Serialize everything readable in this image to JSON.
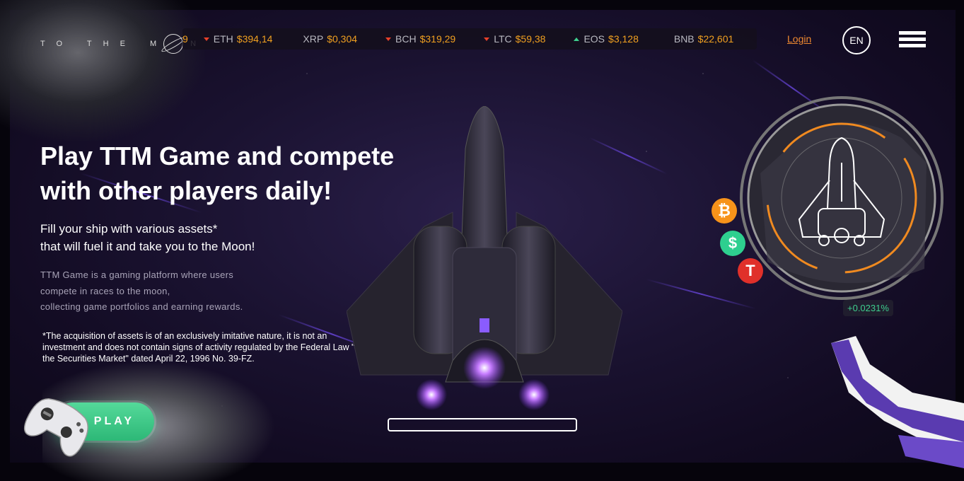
{
  "header": {
    "logo_text": "TO THE MOON",
    "logo_left": "TO THE M",
    "logo_right": "N",
    "login_label": "Login",
    "lang_label": "EN",
    "menu_icon": "hamburger-menu-icon"
  },
  "ticker": {
    "partial_first": "9",
    "items": [
      {
        "symbol": "ETH",
        "price": "$394,14",
        "trend": "down"
      },
      {
        "symbol": "XRP",
        "price": "$0,304",
        "trend": "none"
      },
      {
        "symbol": "BCH",
        "price": "$319,29",
        "trend": "down"
      },
      {
        "symbol": "LTC",
        "price": "$59,38",
        "trend": "down"
      },
      {
        "symbol": "EOS",
        "price": "$3,128",
        "trend": "up"
      },
      {
        "symbol": "BNB",
        "price": "$22,601",
        "trend": "none"
      }
    ]
  },
  "hero": {
    "headline": "Play TTM Game and compete with other players daily!",
    "subhead_line1": "Fill your ship with various assets*",
    "subhead_line2": "that will fuel it and take you to the Moon!",
    "desc_line1": "TTM Game is a gaming platform where users",
    "desc_line2": "compete in races to the moon,",
    "desc_line3": "collecting game portfolios and earning rewards.",
    "disclaimer": "*The acquisition of assets is of an exclusively imitative nature, it is not an investment and does not contain signs of activity regulated by the Federal Law \"On the Securities Market\" dated April 22, 1996 No. 39-FZ."
  },
  "play_button": {
    "label": "PLAY"
  },
  "radar": {
    "change": "+0.0231%",
    "coins": [
      "bitcoin-icon",
      "dollar-icon",
      "tesla-icon"
    ]
  },
  "colors": {
    "accent_orange": "#f08a30",
    "price_gold": "#f0a020",
    "up_green": "#3ecf8e",
    "down_red": "#e8402a",
    "play_green": "#3fcf8a",
    "bg_purple": "#1a1230"
  }
}
